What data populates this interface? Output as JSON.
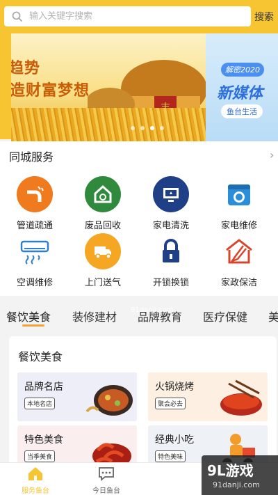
{
  "search": {
    "placeholder": "输入关键字搜索",
    "button_label": "搜索",
    "icon": "search-icon"
  },
  "banner": {
    "left_line1": "趋势",
    "left_line2": "造财富梦想",
    "right_tag": "解密2020",
    "right_title": "新媒体",
    "right_sub": "鱼台生活",
    "active_dot": 3,
    "dot_count": 4
  },
  "service": {
    "title": "同城服务",
    "more_icon": "chevron-right-icon",
    "items": [
      {
        "label": "管道疏通",
        "icon": "pipe-icon",
        "color": "#f07a1e"
      },
      {
        "label": "废品回收",
        "icon": "recycle-house-icon",
        "color": "#2f8a3e"
      },
      {
        "label": "家电清洗",
        "icon": "tv-clean-icon",
        "color": "#1f3f86"
      },
      {
        "label": "家电维修",
        "icon": "washer-icon",
        "color": "#2a8fd8"
      },
      {
        "label": "空调维修",
        "icon": "air-conditioner-icon",
        "color": "#2f7fc9"
      },
      {
        "label": "上门送气",
        "icon": "gas-truck-icon",
        "color": "#f5a623"
      },
      {
        "label": "开锁换锁",
        "icon": "lock-icon",
        "color": "#1f3f86"
      },
      {
        "label": "家政保洁",
        "icon": "broom-house-icon",
        "color": "#d9452b"
      }
    ]
  },
  "tabs": [
    "餐饮美食",
    "装修建材",
    "品牌教育",
    "医疗保健",
    "美"
  ],
  "watermark_mid": "91danji.com",
  "food_card": {
    "title": "餐饮美食",
    "items": [
      {
        "name": "品牌名店",
        "badge": "本地名店",
        "bg": "#eeeef8"
      },
      {
        "name": "火锅烧烤",
        "badge": "聚会必去",
        "bg": "#fdf0e2"
      },
      {
        "name": "特色美食",
        "badge": "当季美食",
        "bg": "#fbeeee"
      },
      {
        "name": "经典小吃",
        "badge": "特色美味",
        "bg": "#eef1f6"
      }
    ]
  },
  "bottom_nav": {
    "items": [
      {
        "label": "服务鱼台",
        "icon": "home-icon",
        "active": true
      },
      {
        "label": "今日鱼台",
        "icon": "chat-bubble-icon",
        "active": false
      }
    ],
    "active_color": "#f6c531"
  },
  "watermark": {
    "main": "9L游戏",
    "sub": "91danji.com"
  }
}
